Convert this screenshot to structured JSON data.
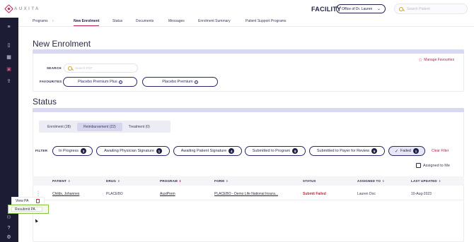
{
  "app": {
    "logo_text": "AUXITA",
    "facility_label": "FACILITY",
    "office_selected": "Office of Dr. Lauren",
    "search_placeholder": "Search Patient"
  },
  "nav": [
    {
      "label": "Programs"
    },
    {
      "label": "New Enrolment",
      "active": true
    },
    {
      "label": "Status"
    },
    {
      "label": "Documents"
    },
    {
      "label": "Messages"
    },
    {
      "label": "Enrolment Summary"
    },
    {
      "label": "Patient Support Programs"
    }
  ],
  "new_enrolment": {
    "title": "New Enrolment",
    "search_label": "SEARCH",
    "search_placeholder": "Search PSP",
    "favourites_label": "FAVOURITES",
    "favourites": [
      "Placebo Premium Plus",
      "Placebo Premium"
    ],
    "manage_favourites": "Manage Favourites"
  },
  "status": {
    "title": "Status",
    "tabs": [
      {
        "label": "Enrolment (28)"
      },
      {
        "label": "Reimbursement (22)",
        "active": true
      },
      {
        "label": "Treatment (0)"
      }
    ],
    "filter_label": "FILTER",
    "filters": [
      {
        "label": "In Progress",
        "count": "3"
      },
      {
        "label": "Awaiting Physician Signature",
        "count": "1"
      },
      {
        "label": "Awaiting Patient Signature",
        "count": "4"
      },
      {
        "label": "Submitted to Program",
        "count": "8"
      },
      {
        "label": "Submitted to Payer for Review",
        "count": "5"
      },
      {
        "label": "Failed",
        "count": "1",
        "active": true
      }
    ],
    "clear_filter": "Clear Filter",
    "assigned_to_me": "Assigned to Me",
    "columns": [
      "PATIENT",
      "DRUG",
      "PROGRAM",
      "FORM",
      "STATUS",
      "ASSIGNED TO",
      "LAST UPDATED"
    ],
    "rows": [
      {
        "patient": "Childs, Johannes",
        "drug": "PLACEBO",
        "program": "AuxiPrem",
        "form": "PLACEBO - Demo Life National Insura...",
        "status": "Submit Failed",
        "assigned_to": "Lauren Doc",
        "last_updated": "10-Aug-2023"
      }
    ]
  },
  "context_menu": {
    "view_label": "View PA",
    "resubmit_label": "Resubmit PA"
  },
  "colors": {
    "accent": "#b3245a",
    "navy": "#1f2144",
    "sidebar": "#1c1d34",
    "band": "#d8d8f2",
    "highlight": "#8bc34a",
    "failed": "#c22b3c"
  }
}
